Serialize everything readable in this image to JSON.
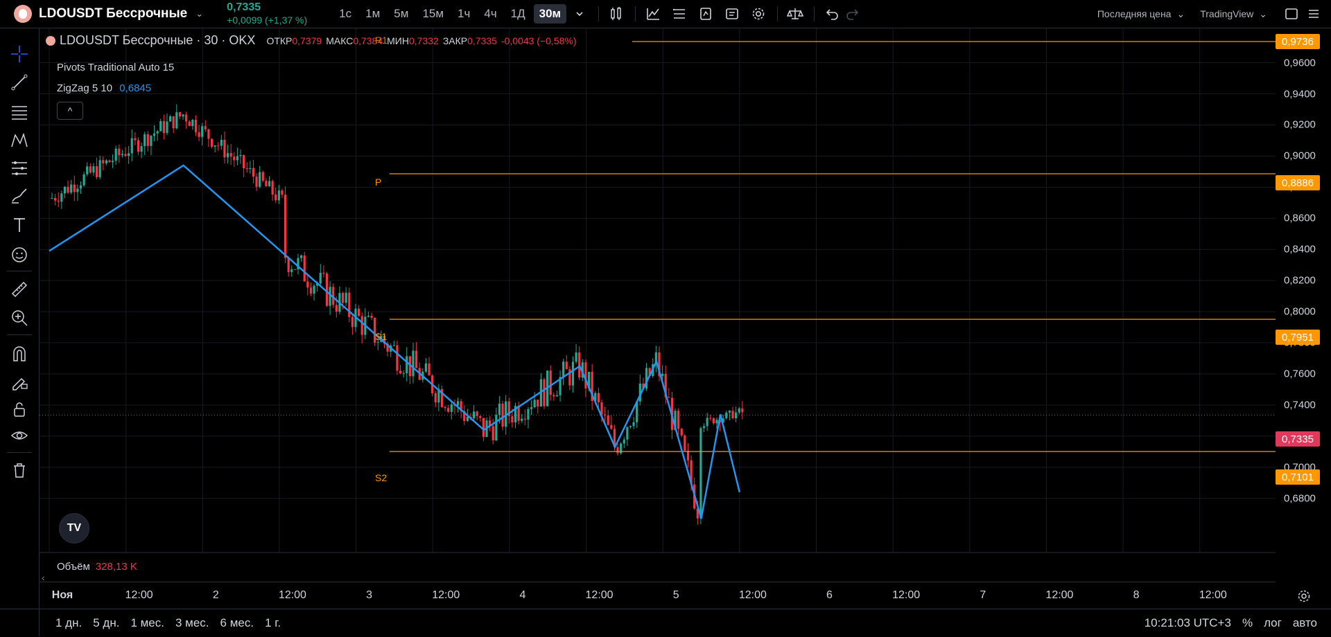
{
  "header": {
    "symbol": "LDOUSDT Бессрочные",
    "price": "0,7335",
    "change": "+0,0099 (+1,37 %)",
    "intervals": [
      "1с",
      "1м",
      "5м",
      "15м",
      "1ч",
      "4ч",
      "1Д",
      "30м"
    ],
    "active_interval": "30м",
    "price_type": "Последняя цена",
    "source": "TradingView",
    "icons": [
      "chevron-down-icon",
      "bar-style-icon",
      "indicators-icon",
      "templates-icon",
      "alert-icon",
      "replay-icon",
      "settings-icon",
      "compare-icon",
      "undo-icon",
      "redo-icon",
      "fullscreen-icon"
    ]
  },
  "legend": {
    "title": "LDOUSDT Бессрочные · 30 · OKX",
    "open_label": "ОТКР",
    "open": "0,7379",
    "high_label": "МАКС",
    "high": "0,7384",
    "low_label": "МИН",
    "low": "0,7332",
    "close_label": "ЗАКР",
    "close": "0,7335",
    "change": "-0,0043 (−0,58%)",
    "indicator1": "Pivots Traditional Auto 15",
    "indicator2_name": "ZigZag 5 10",
    "indicator2_value": "0,6845",
    "collapse": "^"
  },
  "volume": {
    "label": "Объём",
    "value": "328,13 K"
  },
  "price_axis": [
    "0,9600",
    "0,9400",
    "0,9200",
    "0,9000",
    "0,8800",
    "0,8600",
    "0,8400",
    "0,8200",
    "0,8000",
    "0,7800",
    "0,7600",
    "0,7400",
    "0,7200",
    "0,7000",
    "0,6800"
  ],
  "price_labels": {
    "r1": "0,9736",
    "p": "0,8886",
    "s1": "0,7951",
    "current": "0,7335",
    "s2": "0,7101"
  },
  "pivot_names": {
    "r1": "R1",
    "p": "P",
    "s1": "S1",
    "s2": "S2"
  },
  "time_axis": [
    "Ноя",
    "12:00",
    "2",
    "12:00",
    "3",
    "12:00",
    "4",
    "12:00",
    "5",
    "12:00",
    "6",
    "12:00",
    "7",
    "12:00",
    "8",
    "12:00"
  ],
  "bottom": {
    "ranges": [
      "1 дн.",
      "5 дн.",
      "1 мес.",
      "3 мес.",
      "6 мес.",
      "1 г."
    ],
    "clock": "10:21:03 UTC+3",
    "percent": "%",
    "log": "лог",
    "auto": "авто"
  },
  "colors": {
    "up": "#22ab94",
    "down": "#f23645",
    "pivot": "#ff9800",
    "zigzag": "#2196f3",
    "current_price": "#e0395b"
  },
  "chart_data": {
    "type": "candlestick",
    "interval": "30м",
    "ylim": [
      0.665,
      0.982
    ],
    "pivots": {
      "R1": 0.9736,
      "P": 0.8886,
      "S1": 0.7951,
      "S2": 0.7101
    },
    "current_price": 0.7335,
    "zigzag": [
      {
        "x": "1 Ноя 00:00",
        "y": 0.839
      },
      {
        "x": "1 Ноя 21:00",
        "y": 0.894
      },
      {
        "x": "3 Ноя 20:00",
        "y": 0.724
      },
      {
        "x": "4 Ноя 11:00",
        "y": 0.765
      },
      {
        "x": "4 Ноя 16:30",
        "y": 0.713
      },
      {
        "x": "4 Ноя 23:00",
        "y": 0.768
      },
      {
        "x": "5 Ноя 06:00",
        "y": 0.667
      },
      {
        "x": "5 Ноя 09:00",
        "y": 0.734
      },
      {
        "x": "5 Ноя 12:00",
        "y": 0.684
      }
    ]
  }
}
